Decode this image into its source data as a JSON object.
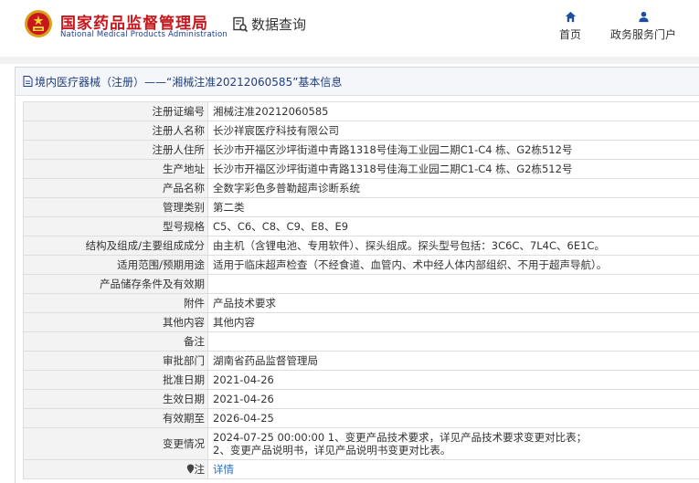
{
  "header": {
    "title_cn": "国家药品监督管理局",
    "title_en": "National Medical Products Administration",
    "data_query": "数据查询",
    "nav": [
      {
        "label": "首页",
        "icon": "home-icon"
      },
      {
        "label": "政务服务门户",
        "icon": "user-icon"
      }
    ],
    "brand_color": "#c8161d"
  },
  "breadcrumb": {
    "text": "境内医疗器械（注册）——“湘械注准20212060585”基本信息"
  },
  "rows": [
    {
      "label": "注册证编号",
      "value": "湘械注准20212060585"
    },
    {
      "label": "注册人名称",
      "value": "长沙祥宸医疗科技有限公司"
    },
    {
      "label": "注册人住所",
      "value": "长沙市开福区沙坪街道中青路1318号佳海工业园二期C1-C4 栋、G2栋512号"
    },
    {
      "label": "生产地址",
      "value": "长沙市开福区沙坪街道中青路1318号佳海工业园二期C1-C4 栋、G2栋512号"
    },
    {
      "label": "产品名称",
      "value": "全数字彩色多普勒超声诊断系统"
    },
    {
      "label": "管理类别",
      "value": "第二类"
    },
    {
      "label": "型号规格",
      "value": "C5、C6、C8、C9、E8、E9"
    },
    {
      "label": "结构及组成/主要组成成分",
      "value": "由主机（含锂电池、专用软件）、探头组成。探头型号包括：3C6C、7L4C、6E1C。"
    },
    {
      "label": "适用范围/预期用途",
      "value": "适用于临床超声检查（不经食道、血管内、术中经人体内部组织、不用于超声导航）。"
    },
    {
      "label": "产品储存条件及有效期",
      "value": ""
    },
    {
      "label": "附件",
      "value": "产品技术要求"
    },
    {
      "label": "其他内容",
      "value": "其他内容"
    },
    {
      "label": "备注",
      "value": ""
    },
    {
      "label": "审批部门",
      "value": "湖南省药品监督管理局"
    },
    {
      "label": "批准日期",
      "value": "2021-04-26"
    },
    {
      "label": "生效日期",
      "value": "2021-04-26"
    },
    {
      "label": "有效期至",
      "value": "2026-04-25"
    }
  ],
  "change": {
    "label": "变更情况",
    "line1": "2024-07-25 00:00:00 1、变更产品技术要求，详见产品技术要求变更对比表；",
    "line2": "2、变更产品说明书，详见产品说明书变更对比表。"
  },
  "notes": {
    "label": "注",
    "link": "详情"
  }
}
